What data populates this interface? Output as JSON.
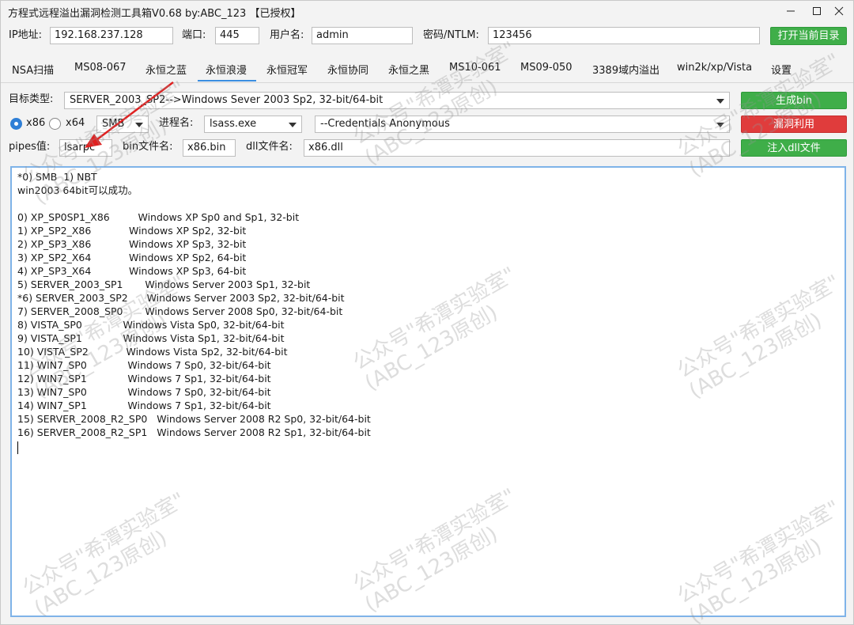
{
  "window": {
    "title": "方程式远程溢出漏洞检测工具箱V0.68 by:ABC_123 【已授权】"
  },
  "connection": {
    "ip_label": "IP地址:",
    "ip_value": "192.168.237.128",
    "port_label": "端口:",
    "port_value": "445",
    "user_label": "用户名:",
    "user_value": "admin",
    "pass_label": "密码/NTLM:",
    "pass_value": "123456",
    "open_dir_button": "打开当前目录"
  },
  "tabs": [
    {
      "label": "NSA扫描"
    },
    {
      "label": "MS08-067"
    },
    {
      "label": "永恒之蓝"
    },
    {
      "label": "永恒浪漫",
      "active": true
    },
    {
      "label": "永恒冠军"
    },
    {
      "label": "永恒协同"
    },
    {
      "label": "永恒之黑"
    },
    {
      "label": "MS10-061"
    },
    {
      "label": "MS09-050"
    },
    {
      "label": "3389域内溢出"
    },
    {
      "label": "win2k/xp/Vista"
    },
    {
      "label": "设置"
    }
  ],
  "form": {
    "target_label": "目标类型:",
    "target_value": "SERVER_2003_SP2-->Windows Sever 2003 Sp2, 32-bit/64-bit",
    "arch_x86": "x86",
    "arch_x64": "x64",
    "arch_selected": "x86",
    "protocol_value": "SMB",
    "process_label": "进程名:",
    "process_value": "lsass.exe",
    "credentials_value": "--Credentials Anonymous",
    "pipes_label": "pipes值:",
    "pipes_value": "lsarpc",
    "bin_label": "bin文件名:",
    "bin_value": "x86.bin",
    "dll_label": "dll文件名:",
    "dll_value": "x86.dll",
    "gen_bin_button": "生成bin",
    "exploit_button": "漏洞利用",
    "inject_dll_button": "注入dll文件"
  },
  "output": {
    "lines": [
      "*0) SMB  1) NBT",
      "win2003 64bit可以成功。",
      "",
      "0) XP_SP0SP1_X86         Windows XP Sp0 and Sp1, 32-bit",
      "1) XP_SP2_X86            Windows XP Sp2, 32-bit",
      "2) XP_SP3_X86            Windows XP Sp3, 32-bit",
      "3) XP_SP2_X64            Windows XP Sp2, 64-bit",
      "4) XP_SP3_X64            Windows XP Sp3, 64-bit",
      "5) SERVER_2003_SP1       Windows Server 2003 Sp1, 32-bit",
      "*6) SERVER_2003_SP2      Windows Server 2003 Sp2, 32-bit/64-bit",
      "7) SERVER_2008_SP0       Windows Server 2008 Sp0, 32-bit/64-bit",
      "8) VISTA_SP0             Windows Vista Sp0, 32-bit/64-bit",
      "9) VISTA_SP1             Windows Vista Sp1, 32-bit/64-bit",
      "10) VISTA_SP2            Windows Vista Sp2, 32-bit/64-bit",
      "11) WIN7_SP0             Windows 7 Sp0, 32-bit/64-bit",
      "12) WIN7_SP1             Windows 7 Sp1, 32-bit/64-bit",
      "13) WIN7_SP0             Windows 7 Sp0, 32-bit/64-bit",
      "14) WIN7_SP1             Windows 7 Sp1, 32-bit/64-bit",
      "15) SERVER_2008_R2_SP0   Windows Server 2008 R2 Sp0, 32-bit/64-bit",
      "16) SERVER_2008_R2_SP1   Windows Server 2008 R2 Sp1, 32-bit/64-bit"
    ]
  },
  "watermark": {
    "line1": "公众号\"希潭实验室\"",
    "line2": "(ABC_123原创)"
  },
  "colors": {
    "accent": "#3b8ee0",
    "green_button": "#3fae49",
    "red_button": "#e03c3c",
    "annotation_arrow": "#e02020"
  }
}
